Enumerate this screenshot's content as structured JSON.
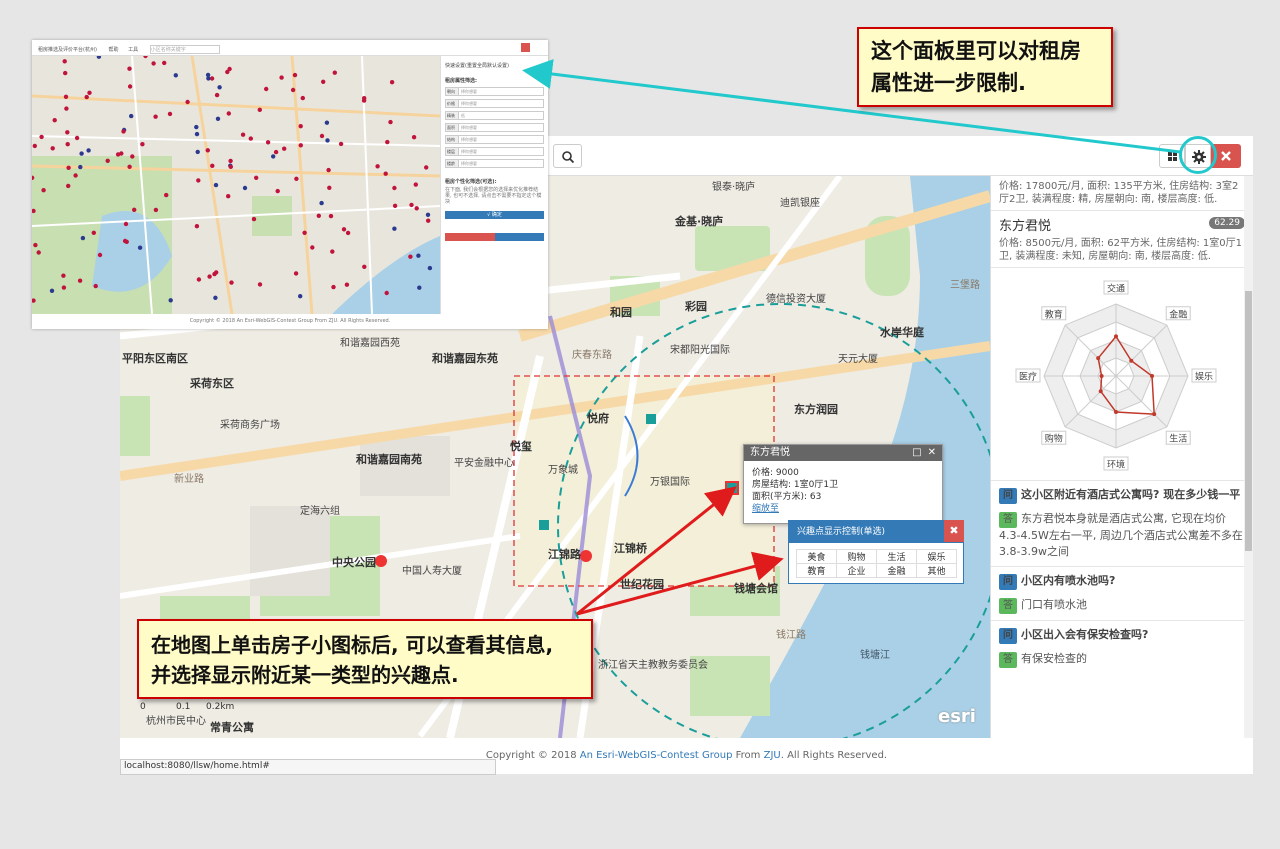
{
  "toolbar": {
    "search_icon": "search-icon",
    "grid_icon": "grid-icon",
    "gear_icon": "gear-icon",
    "close_icon": "close-icon"
  },
  "map": {
    "labels": [
      "金基·晓庐",
      "彩园",
      "和园",
      "水岸华庭",
      "东方润园",
      "宋都阳光国际",
      "悦府",
      "悦玺",
      "和谐嘉园东苑",
      "和谐嘉园南苑",
      "和谐嘉园西苑",
      "平安金融中心",
      "万象城",
      "万银国际",
      "江锦路",
      "江锦桥",
      "世纪花园",
      "钱塘会馆",
      "中央公园",
      "中国人寿大厦",
      "杭州市民中心",
      "常青公寓",
      "定海六组",
      "新业路",
      "平阳东区南区",
      "采荷东区",
      "采荷商务广场",
      "浙江省天主教教务委员会",
      "天元大厦",
      "迪凯银座",
      "银泰·晓庐",
      "德信投资大厦",
      "庆春东路",
      "钱江路",
      "钱塘江",
      "三堡路"
    ],
    "scale_labels": [
      "0",
      "0.1",
      "0.2km"
    ],
    "attribution": "POWERED BY esri"
  },
  "popup": {
    "title": "东方君悦",
    "price": "价格: 9000",
    "structure": "房屋结构: 1室0厅1卫",
    "area": "面积(平方米): 63",
    "zoom_link": "缩放至"
  },
  "poi_control": {
    "title": "兴趣点显示控制(单选)",
    "close": "✖",
    "options": [
      [
        "美食",
        "购物",
        "生活",
        "娱乐"
      ],
      [
        "教育",
        "企业",
        "金融",
        "其他"
      ]
    ]
  },
  "panel": {
    "listing1_desc": "价格: 17800元/月, 面积: 135平方米, 住房结构: 3室2厅2卫, 装满程度: 精, 房屋朝向: 南, 楼层高度: 低.",
    "listing2_name": "东方君悦",
    "listing2_score": "62.29",
    "listing2_desc": "价格: 8500元/月, 面积: 62平方米, 住房结构: 1室0厅1卫, 装满程度: 未知, 房屋朝向: 南, 楼层高度: 低.",
    "radar_axes": [
      "交通",
      "金融",
      "娱乐",
      "生活",
      "环境",
      "购物",
      "医疗",
      "教育"
    ],
    "radar_values": [
      0.55,
      0.3,
      0.5,
      0.75,
      0.5,
      0.3,
      0.2,
      0.35
    ],
    "q_tag": "问",
    "a_tag": "答",
    "qa": [
      {
        "q": "这小区附近有酒店式公寓吗? 现在多少钱一平",
        "a": "东方君悦本身就是酒店式公寓, 它现在均价4.3-4.5W左右一平, 周边几个酒店式公寓差不多在3.8-3.9w之间"
      },
      {
        "q": "小区内有喷水池吗?",
        "a": "门口有喷水池"
      },
      {
        "q": "小区出入会有保安检查吗?",
        "a": "有保安检查的"
      }
    ]
  },
  "footer": {
    "prefix": "Copyright © 2018 ",
    "group_link": "An Esri-WebGIS-Contest Group",
    "mid": " From ",
    "org_link": "ZJU",
    "suffix": ". All Rights Reserved."
  },
  "statusbar": {
    "url": "localhost:8080/llsw/home.html#"
  },
  "inset": {
    "title": "租房推选及评价平台(杭州)",
    "nav1": "帮助",
    "nav2": "工具",
    "search_placeholder": "小区名称关键字",
    "quick_set": "快速设置(重置全局默认设置)",
    "attr_filter": "租房属性筛选:",
    "rows": [
      [
        "朝向",
        "择你想要"
      ],
      [
        "价格",
        "择你想要"
      ],
      [
        "精装",
        "低"
      ],
      [
        "面积",
        "择你想要"
      ],
      [
        "结构",
        "择你想要"
      ],
      [
        "楼层",
        "择你想要"
      ],
      [
        "楼龄",
        "择你想要"
      ]
    ],
    "pref_filter": "租房个性化筛选(可选):",
    "pref_desc": "在下面, 我们会根据您的选择来优化推荐结果, 也可不选择, 请点击不需要不指定这个模块",
    "ok": "√ 确定",
    "footer": "Copyright © 2018 An Esri-WebGIS-Contest Group From ZJU. All Rights Reserved."
  },
  "annotations": {
    "top": "这个面板里可以对租房属性进一步限制.",
    "bottom": "在地图上单击房子小图标后, 可以查看其信息, 并选择显示附近某一类型的兴趣点."
  },
  "colors": {
    "primary": "#337ab7",
    "danger": "#d9534f",
    "success": "#5cb85c",
    "callout_bg": "#fffcc8",
    "callout_border": "#cc0000",
    "highlight_ring": "#21c8cc",
    "radar_line": "#c0392b"
  }
}
